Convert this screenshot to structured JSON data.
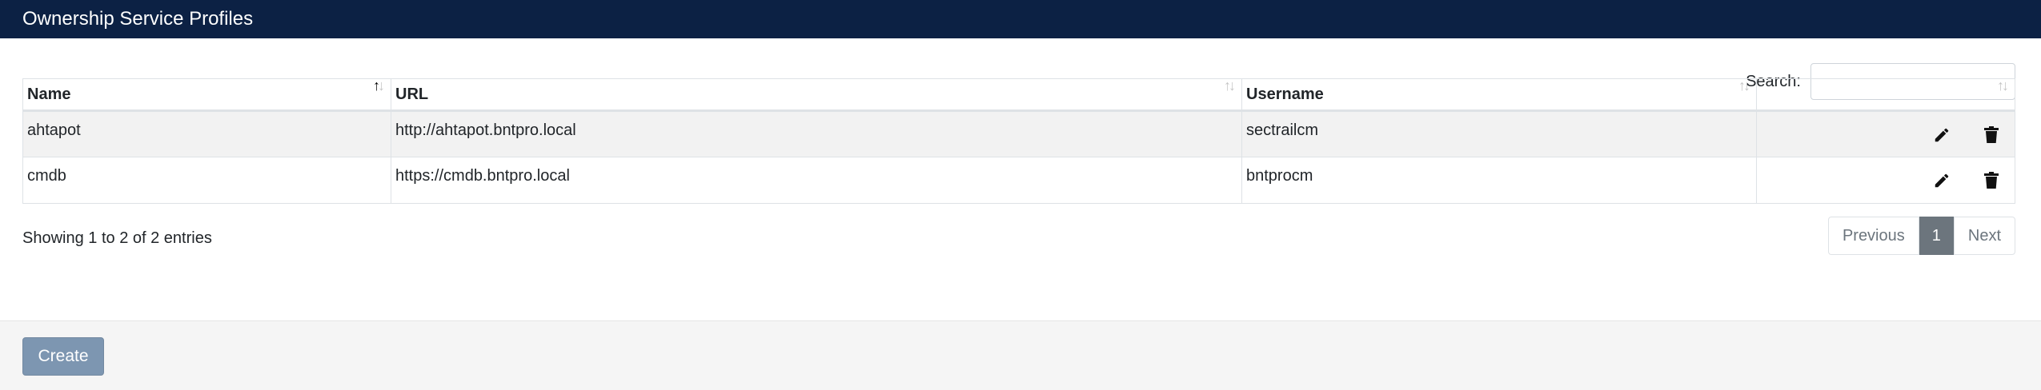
{
  "header": {
    "title": "Ownership Service Profiles"
  },
  "search": {
    "label": "Search:",
    "value": "",
    "placeholder": ""
  },
  "table": {
    "columns": [
      {
        "label": "Name",
        "sort": "ascending"
      },
      {
        "label": "URL",
        "sort": "none"
      },
      {
        "label": "Username",
        "sort": "none"
      },
      {
        "label": "",
        "sort": "none"
      }
    ],
    "rows": [
      {
        "name": "ahtapot",
        "url": "http://ahtapot.bntpro.local",
        "username": "sectrailcm"
      },
      {
        "name": "cmdb",
        "url": "https://cmdb.bntpro.local",
        "username": "bntprocm"
      }
    ],
    "row_actions": [
      "pencil-icon",
      "trash-icon"
    ]
  },
  "info": {
    "text": "Showing 1 to 2 of 2 entries"
  },
  "pagination": {
    "previous": "Previous",
    "current": "1",
    "next": "Next"
  },
  "footer": {
    "create_label": "Create"
  },
  "colors": {
    "header_bg": "#0c2144",
    "create_bg": "#7d96b1",
    "active_page_bg": "#6c757d",
    "odd_row_bg": "#f2f2f2",
    "footer_bg": "#f5f5f5"
  }
}
